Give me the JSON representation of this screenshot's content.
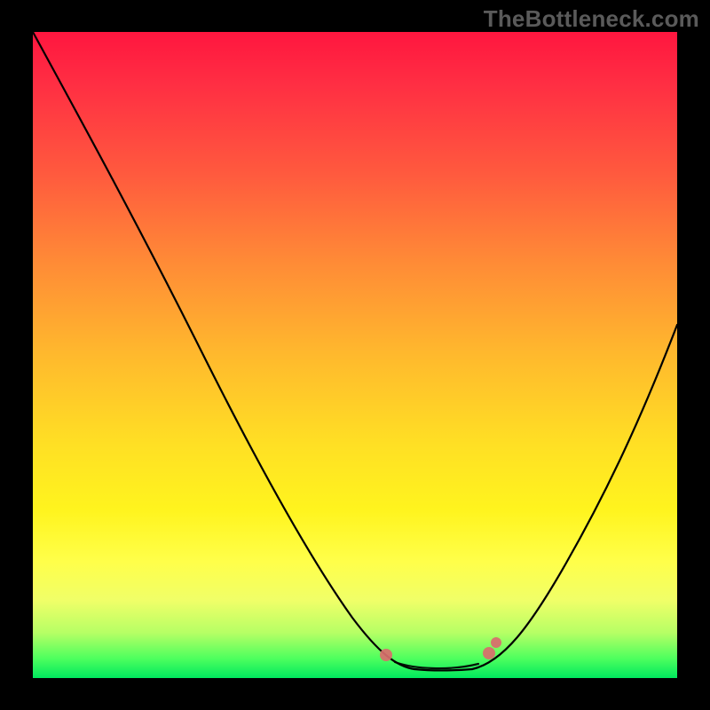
{
  "watermark": "TheBottleneck.com",
  "colors": {
    "background": "#000000",
    "gradient_top": "#ff163f",
    "gradient_bottom": "#00e85e",
    "curve": "#000000",
    "highlight": "#d96d6d"
  },
  "chart_data": {
    "type": "line",
    "title": "",
    "xlabel": "",
    "ylabel": "",
    "xlim": [
      0,
      100
    ],
    "ylim": [
      0,
      100
    ],
    "series": [
      {
        "name": "bottleneck-curve",
        "x": [
          0,
          10,
          20,
          30,
          40,
          48,
          52,
          56,
          60,
          64,
          70,
          78,
          86,
          94,
          100
        ],
        "values": [
          100,
          85,
          70,
          55,
          38,
          18,
          10,
          3,
          2,
          2,
          3,
          14,
          30,
          48,
          60
        ]
      }
    ],
    "annotations": [
      {
        "name": "optimal-flat-region",
        "x_start": 56,
        "x_end": 70,
        "y": 2
      }
    ]
  }
}
